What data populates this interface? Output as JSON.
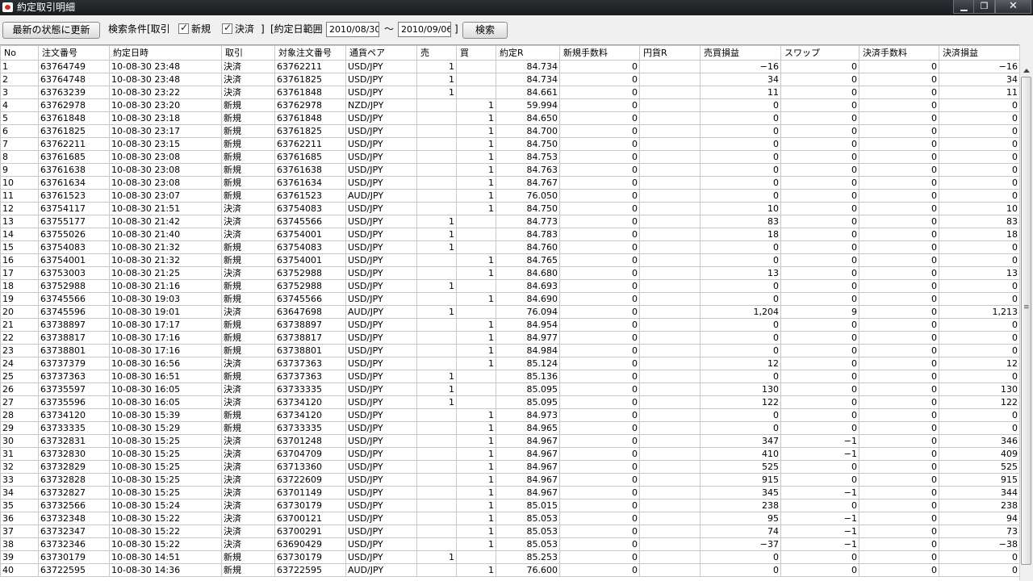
{
  "window": {
    "title": "約定取引明細",
    "minimize": "▁",
    "restore": "❐",
    "close": "✕",
    "icon": "app-icon"
  },
  "toolbar": {
    "refresh_label": "最新の状態に更新",
    "search_condition_label": "検索条件[取引",
    "new_label": "新規",
    "settle_label": "決済",
    "bracket_close": "]",
    "date_range_label": "[約定日範囲",
    "date_from": "2010/08/30",
    "tilde": "〜",
    "date_to": "2010/09/06",
    "bracket_close2": "]",
    "search_label": "検索"
  },
  "table": {
    "columns": [
      "No",
      "注文番号",
      "約定日時",
      "取引",
      "対象注文番号",
      "通貨ペア",
      "売",
      "買",
      "約定R",
      "新規手数料",
      "円貨R",
      "売買損益",
      "スワップ",
      "決済手数料",
      "決済損益"
    ],
    "rows": [
      [
        "1",
        "63764749",
        "10-08-30 23:48",
        "決済",
        "63762211",
        "USD/JPY",
        "1",
        "",
        "84.734",
        "0",
        "",
        "−16",
        "0",
        "0",
        "−16"
      ],
      [
        "2",
        "63764748",
        "10-08-30 23:48",
        "決済",
        "63761825",
        "USD/JPY",
        "1",
        "",
        "84.734",
        "0",
        "",
        "34",
        "0",
        "0",
        "34"
      ],
      [
        "3",
        "63763239",
        "10-08-30 23:22",
        "決済",
        "63761848",
        "USD/JPY",
        "1",
        "",
        "84.661",
        "0",
        "",
        "11",
        "0",
        "0",
        "11"
      ],
      [
        "4",
        "63762978",
        "10-08-30 23:20",
        "新規",
        "63762978",
        "NZD/JPY",
        "",
        "1",
        "59.994",
        "0",
        "",
        "0",
        "0",
        "0",
        "0"
      ],
      [
        "5",
        "63761848",
        "10-08-30 23:18",
        "新規",
        "63761848",
        "USD/JPY",
        "",
        "1",
        "84.650",
        "0",
        "",
        "0",
        "0",
        "0",
        "0"
      ],
      [
        "6",
        "63761825",
        "10-08-30 23:17",
        "新規",
        "63761825",
        "USD/JPY",
        "",
        "1",
        "84.700",
        "0",
        "",
        "0",
        "0",
        "0",
        "0"
      ],
      [
        "7",
        "63762211",
        "10-08-30 23:15",
        "新規",
        "63762211",
        "USD/JPY",
        "",
        "1",
        "84.750",
        "0",
        "",
        "0",
        "0",
        "0",
        "0"
      ],
      [
        "8",
        "63761685",
        "10-08-30 23:08",
        "新規",
        "63761685",
        "USD/JPY",
        "",
        "1",
        "84.753",
        "0",
        "",
        "0",
        "0",
        "0",
        "0"
      ],
      [
        "9",
        "63761638",
        "10-08-30 23:08",
        "新規",
        "63761638",
        "USD/JPY",
        "",
        "1",
        "84.763",
        "0",
        "",
        "0",
        "0",
        "0",
        "0"
      ],
      [
        "10",
        "63761634",
        "10-08-30 23:08",
        "新規",
        "63761634",
        "USD/JPY",
        "",
        "1",
        "84.767",
        "0",
        "",
        "0",
        "0",
        "0",
        "0"
      ],
      [
        "11",
        "63761523",
        "10-08-30 23:07",
        "新規",
        "63761523",
        "AUD/JPY",
        "",
        "1",
        "76.050",
        "0",
        "",
        "0",
        "0",
        "0",
        "0"
      ],
      [
        "12",
        "63754117",
        "10-08-30 21:51",
        "決済",
        "63754083",
        "USD/JPY",
        "",
        "1",
        "84.750",
        "0",
        "",
        "10",
        "0",
        "0",
        "10"
      ],
      [
        "13",
        "63755177",
        "10-08-30 21:42",
        "決済",
        "63745566",
        "USD/JPY",
        "1",
        "",
        "84.773",
        "0",
        "",
        "83",
        "0",
        "0",
        "83"
      ],
      [
        "14",
        "63755026",
        "10-08-30 21:40",
        "決済",
        "63754001",
        "USD/JPY",
        "1",
        "",
        "84.783",
        "0",
        "",
        "18",
        "0",
        "0",
        "18"
      ],
      [
        "15",
        "63754083",
        "10-08-30 21:32",
        "新規",
        "63754083",
        "USD/JPY",
        "1",
        "",
        "84.760",
        "0",
        "",
        "0",
        "0",
        "0",
        "0"
      ],
      [
        "16",
        "63754001",
        "10-08-30 21:32",
        "新規",
        "63754001",
        "USD/JPY",
        "",
        "1",
        "84.765",
        "0",
        "",
        "0",
        "0",
        "0",
        "0"
      ],
      [
        "17",
        "63753003",
        "10-08-30 21:25",
        "決済",
        "63752988",
        "USD/JPY",
        "",
        "1",
        "84.680",
        "0",
        "",
        "13",
        "0",
        "0",
        "13"
      ],
      [
        "18",
        "63752988",
        "10-08-30 21:16",
        "新規",
        "63752988",
        "USD/JPY",
        "1",
        "",
        "84.693",
        "0",
        "",
        "0",
        "0",
        "0",
        "0"
      ],
      [
        "19",
        "63745566",
        "10-08-30 19:03",
        "新規",
        "63745566",
        "USD/JPY",
        "",
        "1",
        "84.690",
        "0",
        "",
        "0",
        "0",
        "0",
        "0"
      ],
      [
        "20",
        "63745596",
        "10-08-30 19:01",
        "決済",
        "63647698",
        "AUD/JPY",
        "1",
        "",
        "76.094",
        "0",
        "",
        "1,204",
        "9",
        "0",
        "1,213"
      ],
      [
        "21",
        "63738897",
        "10-08-30 17:17",
        "新規",
        "63738897",
        "USD/JPY",
        "",
        "1",
        "84.954",
        "0",
        "",
        "0",
        "0",
        "0",
        "0"
      ],
      [
        "22",
        "63738817",
        "10-08-30 17:16",
        "新規",
        "63738817",
        "USD/JPY",
        "",
        "1",
        "84.977",
        "0",
        "",
        "0",
        "0",
        "0",
        "0"
      ],
      [
        "23",
        "63738801",
        "10-08-30 17:16",
        "新規",
        "63738801",
        "USD/JPY",
        "",
        "1",
        "84.984",
        "0",
        "",
        "0",
        "0",
        "0",
        "0"
      ],
      [
        "24",
        "63737379",
        "10-08-30 16:56",
        "決済",
        "63737363",
        "USD/JPY",
        "",
        "1",
        "85.124",
        "0",
        "",
        "12",
        "0",
        "0",
        "12"
      ],
      [
        "25",
        "63737363",
        "10-08-30 16:51",
        "新規",
        "63737363",
        "USD/JPY",
        "1",
        "",
        "85.136",
        "0",
        "",
        "0",
        "0",
        "0",
        "0"
      ],
      [
        "26",
        "63735597",
        "10-08-30 16:05",
        "決済",
        "63733335",
        "USD/JPY",
        "1",
        "",
        "85.095",
        "0",
        "",
        "130",
        "0",
        "0",
        "130"
      ],
      [
        "27",
        "63735596",
        "10-08-30 16:05",
        "決済",
        "63734120",
        "USD/JPY",
        "1",
        "",
        "85.095",
        "0",
        "",
        "122",
        "0",
        "0",
        "122"
      ],
      [
        "28",
        "63734120",
        "10-08-30 15:39",
        "新規",
        "63734120",
        "USD/JPY",
        "",
        "1",
        "84.973",
        "0",
        "",
        "0",
        "0",
        "0",
        "0"
      ],
      [
        "29",
        "63733335",
        "10-08-30 15:29",
        "新規",
        "63733335",
        "USD/JPY",
        "",
        "1",
        "84.965",
        "0",
        "",
        "0",
        "0",
        "0",
        "0"
      ],
      [
        "30",
        "63732831",
        "10-08-30 15:25",
        "決済",
        "63701248",
        "USD/JPY",
        "",
        "1",
        "84.967",
        "0",
        "",
        "347",
        "−1",
        "0",
        "346"
      ],
      [
        "31",
        "63732830",
        "10-08-30 15:25",
        "決済",
        "63704709",
        "USD/JPY",
        "",
        "1",
        "84.967",
        "0",
        "",
        "410",
        "−1",
        "0",
        "409"
      ],
      [
        "32",
        "63732829",
        "10-08-30 15:25",
        "決済",
        "63713360",
        "USD/JPY",
        "",
        "1",
        "84.967",
        "0",
        "",
        "525",
        "0",
        "0",
        "525"
      ],
      [
        "33",
        "63732828",
        "10-08-30 15:25",
        "決済",
        "63722609",
        "USD/JPY",
        "",
        "1",
        "84.967",
        "0",
        "",
        "915",
        "0",
        "0",
        "915"
      ],
      [
        "34",
        "63732827",
        "10-08-30 15:25",
        "決済",
        "63701149",
        "USD/JPY",
        "",
        "1",
        "84.967",
        "0",
        "",
        "345",
        "−1",
        "0",
        "344"
      ],
      [
        "35",
        "63732566",
        "10-08-30 15:24",
        "決済",
        "63730179",
        "USD/JPY",
        "",
        "1",
        "85.015",
        "0",
        "",
        "238",
        "0",
        "0",
        "238"
      ],
      [
        "36",
        "63732348",
        "10-08-30 15:22",
        "決済",
        "63700121",
        "USD/JPY",
        "",
        "1",
        "85.053",
        "0",
        "",
        "95",
        "−1",
        "0",
        "94"
      ],
      [
        "37",
        "63732347",
        "10-08-30 15:22",
        "決済",
        "63700291",
        "USD/JPY",
        "",
        "1",
        "85.053",
        "0",
        "",
        "74",
        "−1",
        "0",
        "73"
      ],
      [
        "38",
        "63732346",
        "10-08-30 15:22",
        "決済",
        "63690429",
        "USD/JPY",
        "",
        "1",
        "85.053",
        "0",
        "",
        "−37",
        "−1",
        "0",
        "−38"
      ],
      [
        "39",
        "63730179",
        "10-08-30 14:51",
        "新規",
        "63730179",
        "USD/JPY",
        "1",
        "",
        "85.253",
        "0",
        "",
        "0",
        "0",
        "0",
        "0"
      ],
      [
        "40",
        "63722595",
        "10-08-30 14:36",
        "新規",
        "63722595",
        "AUD/JPY",
        "",
        "1",
        "76.600",
        "0",
        "",
        "0",
        "0",
        "0",
        "0"
      ]
    ]
  }
}
